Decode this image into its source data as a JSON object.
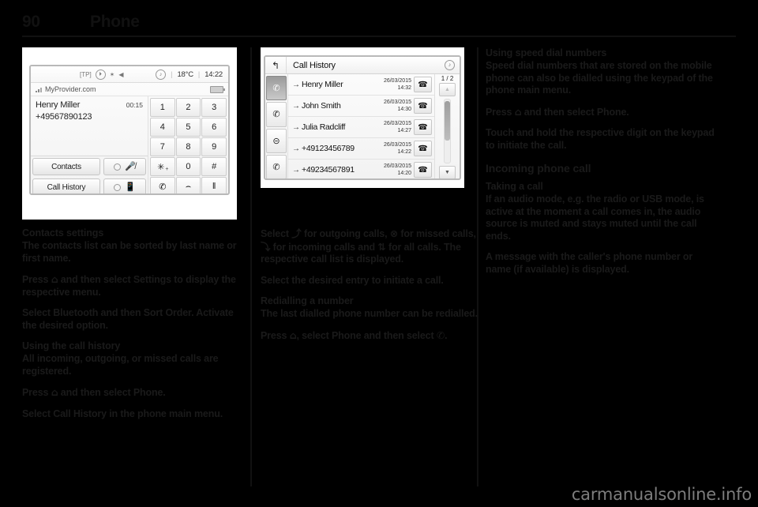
{
  "header": {
    "page_number": "90",
    "title": "Phone"
  },
  "figure_phone_menu": {
    "status_bar": {
      "tp": "[TP]",
      "clock_icon": "clock-circle-icon",
      "bluetooth": "✶",
      "mute": "mute-speaker-icon",
      "music_note": "♪",
      "temperature": "18°C",
      "time": "14:22",
      "separator": "|"
    },
    "provider": "MyProvider.com",
    "caller_name": "Henry Miller",
    "call_duration": "00:15",
    "caller_number": "+49567890123",
    "softkeys": [
      {
        "label": "Contacts",
        "icon": "microphone-muted-icon"
      },
      {
        "label": "Call History",
        "icon": "phone-speaker-icon"
      }
    ],
    "keypad": [
      {
        "label": "1"
      },
      {
        "label": "2"
      },
      {
        "label": "3"
      },
      {
        "label": "4"
      },
      {
        "label": "5"
      },
      {
        "label": "6"
      },
      {
        "label": "7"
      },
      {
        "label": "8"
      },
      {
        "label": "9"
      },
      {
        "label": "✳",
        "sup": "+"
      },
      {
        "label": "0"
      },
      {
        "label": "#"
      }
    ],
    "action_keys": [
      {
        "icon": "✆",
        "name": "call-button"
      },
      {
        "icon": "⌢",
        "name": "end-call-button"
      },
      {
        "icon": "‖",
        "name": "pause-button"
      }
    ]
  },
  "figure_call_history": {
    "back_icon": "↰",
    "title": "Call History",
    "note_icon": "♪",
    "filters": [
      {
        "name": "all-calls-filter",
        "glyph": "✆",
        "active": true
      },
      {
        "name": "incoming-calls-filter",
        "glyph": "✆",
        "active": false
      },
      {
        "name": "missed-calls-filter",
        "glyph": "✆",
        "active": false
      },
      {
        "name": "outgoing-calls-filter",
        "glyph": "✆",
        "active": false
      }
    ],
    "rows": [
      {
        "arrow": "→",
        "name": "Henry Miller",
        "date": "26/03/2015",
        "time": "14:32"
      },
      {
        "arrow": "→",
        "name": "John Smith",
        "date": "26/03/2015",
        "time": "14:30"
      },
      {
        "arrow": "→",
        "name": "Julia Radcliff",
        "date": "26/03/2015",
        "time": "14:27"
      },
      {
        "arrow": "→",
        "name": "+49123456789",
        "date": "26/03/2015",
        "time": "14:22"
      },
      {
        "arrow": "→",
        "name": "+49234567891",
        "date": "26/03/2015",
        "time": "14:20"
      }
    ],
    "page_indicator": "1 / 2",
    "scroll_up": "▲",
    "scroll_down": "▼"
  },
  "column1": {
    "heading_contacts_settings": "Contacts settings",
    "p1": "The contacts list can be sorted by last name or first name.",
    "p2_a": "Press ",
    "p2_glyph": "⌂",
    "p2_b": " and then select Settings to display the respective menu.",
    "p3": "Select Bluetooth and then Sort Order. Activate the desired option.",
    "heading_call_history": "Using the call history",
    "p4": "All incoming, outgoing, or missed calls are registered.",
    "p5_a": "Press ",
    "p5_glyph": "⌂",
    "p5_b": " and then select Phone.",
    "p6": "Select Call History in the phone main menu."
  },
  "column2": {
    "p1_a": "Select ",
    "p1_g1": "⤴",
    "p1_b": " for outgoing calls, ",
    "p1_g2": "⊗",
    "p1_c": " for missed calls, ",
    "p1_g3": "⤵",
    "p1_d": " for incoming calls and ",
    "p1_g4": "⇅",
    "p1_e": " for all calls. The respective call list is displayed.",
    "p2": "Select the desired entry to initiate a call.",
    "heading_redial": "Redialling a number",
    "p3": "The last dialled phone number can be redialled.",
    "p4_a": "Press ",
    "p4_g1": "⌂",
    "p4_b": ", select Phone and then select ",
    "p4_g2": "✆",
    "p4_c": "."
  },
  "column3": {
    "heading_speed_dial": "Using speed dial numbers",
    "p1": "Speed dial numbers that are stored on the mobile phone can also be dialled using the keypad of the phone main menu.",
    "p2_a": "Press ",
    "p2_glyph": "⌂",
    "p2_b": " and then select Phone.",
    "p3": "Touch and hold the respective digit on the keypad to initiate the call.",
    "heading_incoming": "Incoming phone call",
    "heading_taking": "Taking a call",
    "p4": "If an audio mode, e.g. the radio or USB mode, is active at the moment a call comes in, the audio source is muted and stays muted until the call ends.",
    "p5": "A message with the caller's phone number or name (if available) is displayed."
  },
  "watermark": "carmanualsonline.info"
}
